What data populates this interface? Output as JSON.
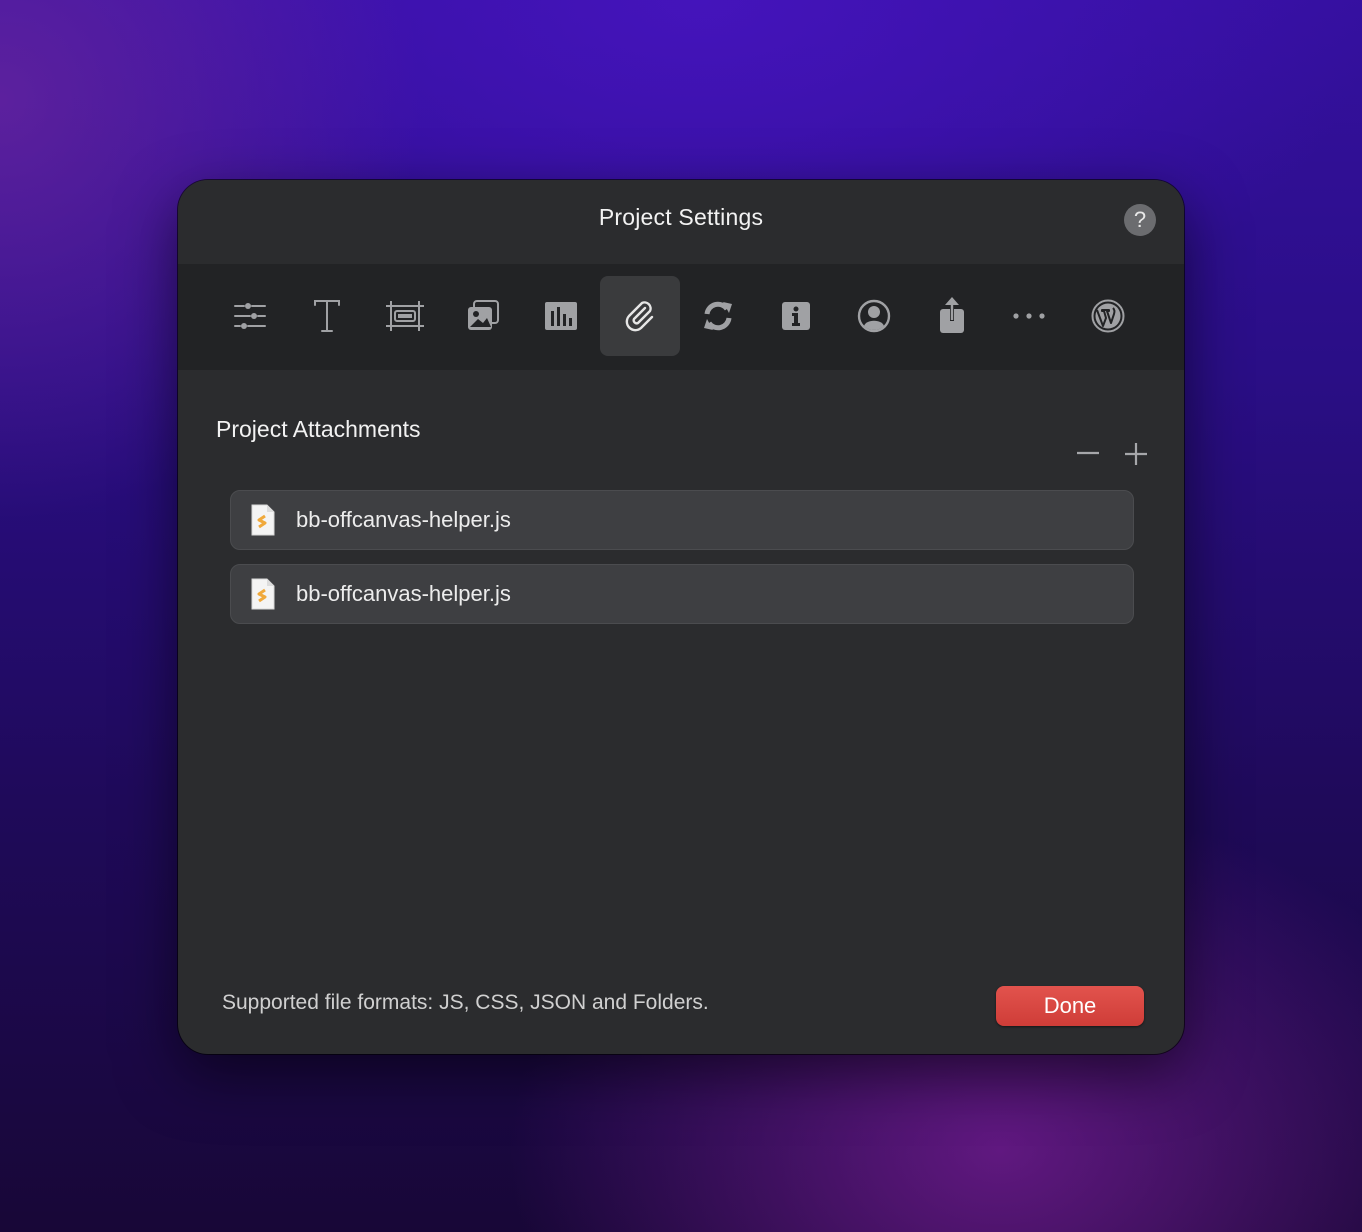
{
  "dialog": {
    "title": "Project Settings",
    "help_label": "?"
  },
  "toolbar": {
    "tabs": [
      {
        "icon": "sliders-icon",
        "name": "tab-general"
      },
      {
        "icon": "text-icon",
        "name": "tab-typography"
      },
      {
        "icon": "layout-icon",
        "name": "tab-layout"
      },
      {
        "icon": "images-icon",
        "name": "tab-images"
      },
      {
        "icon": "chart-icon",
        "name": "tab-analytics"
      },
      {
        "icon": "paperclip-icon",
        "name": "tab-attachments",
        "active": true
      },
      {
        "icon": "sync-icon",
        "name": "tab-sync"
      },
      {
        "icon": "info-icon",
        "name": "tab-info"
      },
      {
        "icon": "user-icon",
        "name": "tab-user"
      },
      {
        "icon": "share-icon",
        "name": "tab-export"
      },
      {
        "icon": "more-icon",
        "name": "tab-more"
      },
      {
        "icon": "wordpress-icon",
        "name": "tab-wordpress"
      }
    ]
  },
  "attachments": {
    "title": "Project Attachments",
    "items": [
      {
        "name": "bb-offcanvas-helper.js",
        "icon": "js-file-icon"
      },
      {
        "name": "bb-offcanvas-helper.js",
        "icon": "js-file-icon"
      }
    ]
  },
  "footer": {
    "supported_formats": "Supported file formats: JS, CSS, JSON and Folders.",
    "done_label": "Done"
  },
  "colors": {
    "accent": "#d9443f",
    "dialog_bg": "#2b2c2e",
    "toolbar_bg": "#222325",
    "js_icon": "#f0a93b"
  }
}
